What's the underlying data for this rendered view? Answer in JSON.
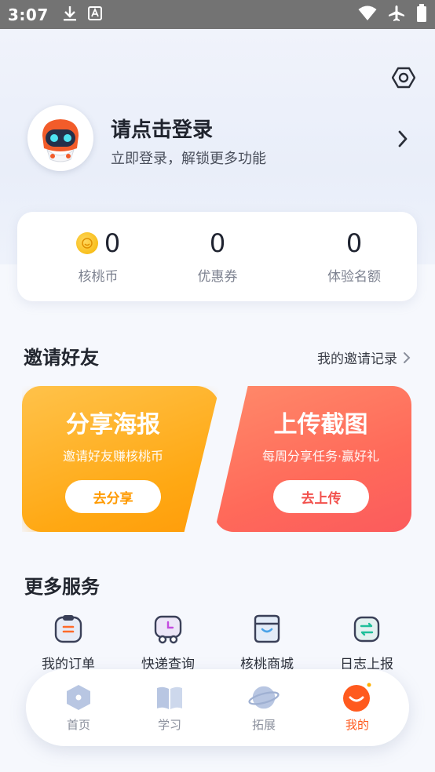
{
  "status_bar": {
    "time": "3:07",
    "left_icons": [
      "download-icon",
      "keyboard-a-icon"
    ],
    "right_icons": [
      "wifi-icon",
      "airplane-icon",
      "battery-icon"
    ]
  },
  "profile": {
    "title": "请点击登录",
    "subtitle": "立即登录，解锁更多功能"
  },
  "stats": [
    {
      "value": "0",
      "label": "核桃币"
    },
    {
      "value": "0",
      "label": "优惠券"
    },
    {
      "value": "0",
      "label": "体验名额"
    }
  ],
  "invite": {
    "title": "邀请好友",
    "link_label": "我的邀请记录",
    "cards": [
      {
        "title": "分享海报",
        "subtitle": "邀请好友赚核桃币",
        "button": "去分享"
      },
      {
        "title": "上传截图",
        "subtitle": "每周分享任务·赢好礼",
        "button": "去上传"
      }
    ]
  },
  "services": {
    "title": "更多服务",
    "items": [
      {
        "label": "我的订单",
        "icon": "order-icon"
      },
      {
        "label": "快递查询",
        "icon": "delivery-icon"
      },
      {
        "label": "核桃商城",
        "icon": "shop-icon"
      },
      {
        "label": "日志上报",
        "icon": "log-upload-icon"
      }
    ]
  },
  "tabs": [
    {
      "label": "首页",
      "icon": "home-icon"
    },
    {
      "label": "学习",
      "icon": "book-icon"
    },
    {
      "label": "拓展",
      "icon": "planet-icon"
    },
    {
      "label": "我的",
      "icon": "profile-icon",
      "active": true
    }
  ],
  "colors": {
    "accent": "#ff5a1e",
    "share_button_text": "#ff9a00",
    "upload_button_text": "#f2504c"
  }
}
